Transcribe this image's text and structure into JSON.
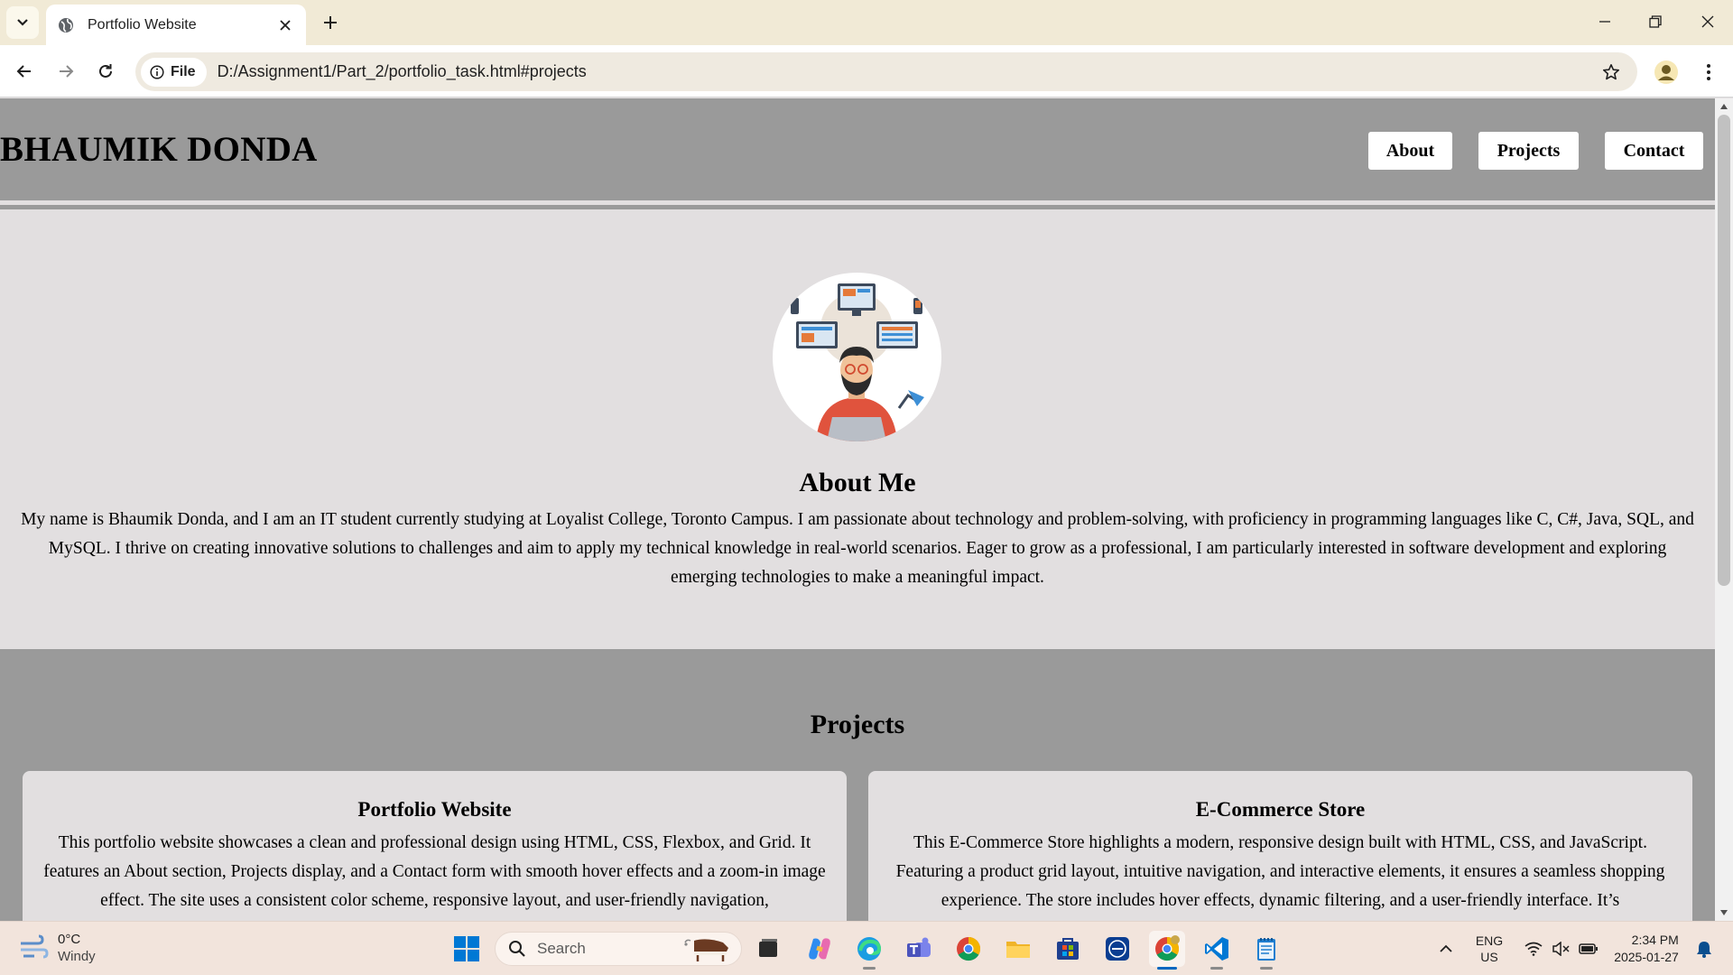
{
  "browser": {
    "tab_title": "Portfolio Website",
    "url_chip": "File",
    "url": "D:/Assignment1/Part_2/portfolio_task.html#projects"
  },
  "site": {
    "brand": "BHAUMIK DONDA",
    "nav": [
      "About",
      "Projects",
      "Contact"
    ],
    "about": {
      "heading": "About Me",
      "text": "My name is Bhaumik Donda, and I am an IT student currently studying at Loyalist College, Toronto Campus. I am passionate about technology and problem-solving, with proficiency in programming languages like C, C#, Java, SQL, and MySQL. I thrive on creating innovative solutions to challenges and aim to apply my technical knowledge in real-world scenarios. Eager to grow as a professional, I am particularly interested in software development and exploring emerging technologies to make a meaningful impact."
    },
    "projects": {
      "heading": "Projects",
      "items": [
        {
          "title": "Portfolio Website",
          "text": "This portfolio website showcases a clean and professional design using HTML, CSS, Flexbox, and Grid. It features an About section, Projects display, and a Contact form with smooth hover effects and a zoom-in image effect. The site uses a consistent color scheme, responsive layout, and user-friendly navigation,"
        },
        {
          "title": "E-Commerce Store",
          "text": "This E-Commerce Store highlights a modern, responsive design built with HTML, CSS, and JavaScript. Featuring a product grid layout, intuitive navigation, and interactive elements, it ensures a seamless shopping experience. The store includes hover effects, dynamic filtering, and a user-friendly interface. It’s"
        }
      ]
    }
  },
  "taskbar": {
    "weather_temp": "0°C",
    "weather_desc": "Windy",
    "search_placeholder": "Search",
    "lang_line1": "ENG",
    "lang_line2": "US",
    "time": "2:34 PM",
    "date": "2025-01-27"
  },
  "colors": {
    "header_bg": "#9a9a9a",
    "page_bg": "#e2dfe0",
    "tabbar_bg": "#f1ead6",
    "taskbar_bg": "#f2e4dc"
  }
}
